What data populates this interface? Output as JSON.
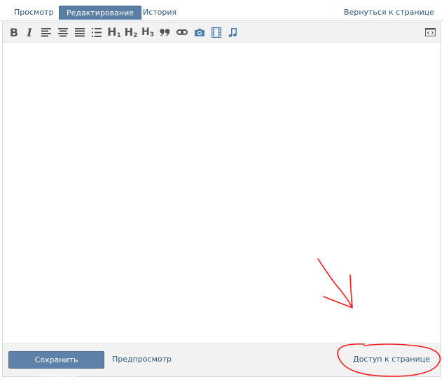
{
  "tabs": {
    "view": "Просмотр",
    "edit": "Редактирование",
    "history": "История"
  },
  "back_link": "Вернуться к странице",
  "toolbar": {
    "buttons": [
      {
        "name": "bold-icon",
        "glyph": "B"
      },
      {
        "name": "italic-icon",
        "glyph": "I"
      },
      {
        "name": "align-left-icon"
      },
      {
        "name": "align-center-icon"
      },
      {
        "name": "align-right-icon"
      },
      {
        "name": "list-icon"
      },
      {
        "name": "heading1-icon",
        "glyph": "H",
        "sub": "1"
      },
      {
        "name": "heading2-icon",
        "glyph": "H",
        "sub": "2"
      },
      {
        "name": "heading3-icon",
        "glyph": "H",
        "sub": "3"
      },
      {
        "name": "quote-icon",
        "glyph": "99"
      },
      {
        "name": "link-icon"
      },
      {
        "name": "photo-icon"
      },
      {
        "name": "video-icon"
      },
      {
        "name": "audio-icon"
      }
    ],
    "source_toggle": "source-code-icon"
  },
  "editor": {
    "content": ""
  },
  "footer": {
    "save_label": "Сохранить страницу",
    "preview_label": "Предпросмотр",
    "access_label": "Доступ к странице"
  },
  "colors": {
    "accent": "#597da3",
    "link": "#2b587a",
    "toolbar_bg": "#f2f2f2",
    "annotation": "#ff1a1a"
  }
}
